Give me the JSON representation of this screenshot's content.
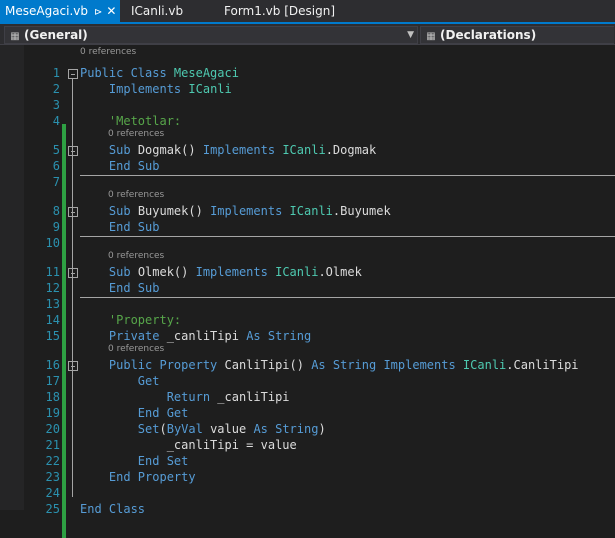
{
  "tabs": [
    {
      "label": "MeseAgaci.vb",
      "active": true,
      "pin": "⊳",
      "close": "✕"
    },
    {
      "label": "ICanli.vb",
      "active": false
    },
    {
      "label": "Form1.vb [Design]",
      "active": false
    }
  ],
  "nav": {
    "left": "(General)",
    "right": "(Declarations)"
  },
  "lens_text": "0 references",
  "lines": [
    {
      "n": "1",
      "tokens": [
        [
          "kw",
          "Public Class "
        ],
        [
          "ty",
          "MeseAgaci"
        ]
      ]
    },
    {
      "n": "2",
      "tokens": [
        [
          "p",
          "    "
        ],
        [
          "kw",
          "Implements "
        ],
        [
          "ty",
          "ICanli"
        ]
      ]
    },
    {
      "n": "3",
      "tokens": []
    },
    {
      "n": "4",
      "tokens": [
        [
          "p",
          "    "
        ],
        [
          "cm",
          "'Metotlar:"
        ]
      ]
    },
    {
      "n": "5",
      "tokens": [
        [
          "p",
          "    "
        ],
        [
          "kw",
          "Sub "
        ],
        [
          "p",
          "Dogmak() "
        ],
        [
          "kw",
          "Implements "
        ],
        [
          "ty",
          "ICanli"
        ],
        [
          "p",
          ".Dogmak"
        ]
      ]
    },
    {
      "n": "6",
      "tokens": [
        [
          "p",
          "    "
        ],
        [
          "kw",
          "End Sub"
        ]
      ]
    },
    {
      "n": "7",
      "tokens": []
    },
    {
      "n": "8",
      "tokens": [
        [
          "p",
          "    "
        ],
        [
          "kw",
          "Sub "
        ],
        [
          "p",
          "Buyumek() "
        ],
        [
          "kw",
          "Implements "
        ],
        [
          "ty",
          "ICanli"
        ],
        [
          "p",
          ".Buyumek"
        ]
      ]
    },
    {
      "n": "9",
      "tokens": [
        [
          "p",
          "    "
        ],
        [
          "kw",
          "End Sub"
        ]
      ]
    },
    {
      "n": "10",
      "tokens": []
    },
    {
      "n": "11",
      "tokens": [
        [
          "p",
          "    "
        ],
        [
          "kw",
          "Sub "
        ],
        [
          "p",
          "Olmek() "
        ],
        [
          "kw",
          "Implements "
        ],
        [
          "ty",
          "ICanli"
        ],
        [
          "p",
          ".Olmek"
        ]
      ]
    },
    {
      "n": "12",
      "tokens": [
        [
          "p",
          "    "
        ],
        [
          "kw",
          "End Sub"
        ]
      ]
    },
    {
      "n": "13",
      "tokens": []
    },
    {
      "n": "14",
      "tokens": [
        [
          "p",
          "    "
        ],
        [
          "cm",
          "'Property:"
        ]
      ]
    },
    {
      "n": "15",
      "tokens": [
        [
          "p",
          "    "
        ],
        [
          "kw",
          "Private "
        ],
        [
          "p",
          "_canliTipi "
        ],
        [
          "kw",
          "As String"
        ]
      ]
    },
    {
      "n": "16",
      "tokens": [
        [
          "p",
          "    "
        ],
        [
          "kw",
          "Public Property "
        ],
        [
          "p",
          "CanliTipi() "
        ],
        [
          "kw",
          "As String Implements "
        ],
        [
          "ty",
          "ICanli"
        ],
        [
          "p",
          ".CanliTipi"
        ]
      ]
    },
    {
      "n": "17",
      "tokens": [
        [
          "p",
          "        "
        ],
        [
          "kw",
          "Get"
        ]
      ]
    },
    {
      "n": "18",
      "tokens": [
        [
          "p",
          "            "
        ],
        [
          "kw",
          "Return "
        ],
        [
          "p",
          "_canliTipi"
        ]
      ]
    },
    {
      "n": "19",
      "tokens": [
        [
          "p",
          "        "
        ],
        [
          "kw",
          "End Get"
        ]
      ]
    },
    {
      "n": "20",
      "tokens": [
        [
          "p",
          "        "
        ],
        [
          "kw",
          "Set"
        ],
        [
          "p",
          "("
        ],
        [
          "kw",
          "ByVal "
        ],
        [
          "p",
          "value "
        ],
        [
          "kw",
          "As String"
        ],
        [
          "p",
          ")"
        ]
      ]
    },
    {
      "n": "21",
      "tokens": [
        [
          "p",
          "            _canliTipi = value"
        ]
      ]
    },
    {
      "n": "22",
      "tokens": [
        [
          "p",
          "        "
        ],
        [
          "kw",
          "End Set"
        ]
      ]
    },
    {
      "n": "23",
      "tokens": [
        [
          "p",
          "    "
        ],
        [
          "kw",
          "End Property"
        ]
      ]
    },
    {
      "n": "24",
      "tokens": []
    },
    {
      "n": "25",
      "tokens": [
        [
          "kw",
          "End Class"
        ]
      ]
    }
  ],
  "colors": {
    "keyword": "#569cd6",
    "type": "#4ec9b0",
    "comment": "#57a64a",
    "line_number": "#2b91af",
    "tab_active": "#007acc"
  }
}
